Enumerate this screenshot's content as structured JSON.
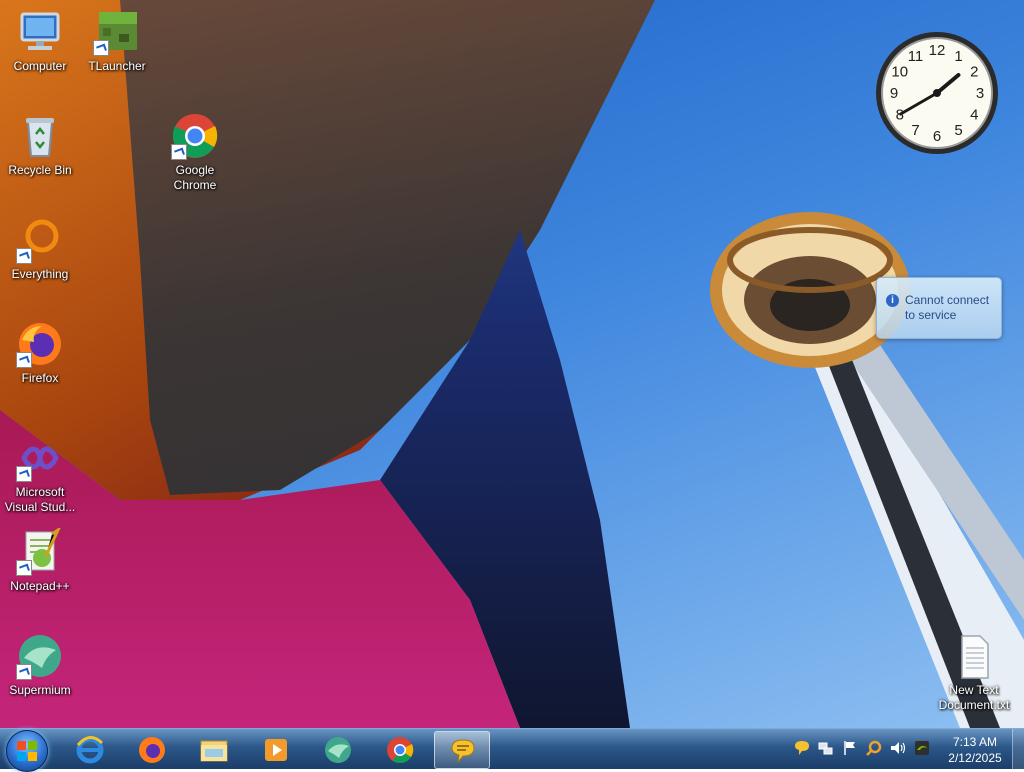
{
  "desktop_icons": [
    {
      "name": "Computer",
      "icon": "computer-icon"
    },
    {
      "name": "TLauncher",
      "icon": "tlauncher-icon"
    },
    {
      "name": "Recycle Bin",
      "icon": "recycle-bin-icon"
    },
    {
      "name": "Google\nChrome",
      "icon": "chrome-icon"
    },
    {
      "name": "Everything",
      "icon": "everything-icon"
    },
    {
      "name": "Firefox",
      "icon": "firefox-icon"
    },
    {
      "name": "Microsoft\nVisual Stud...",
      "icon": "visual-studio-icon"
    },
    {
      "name": "Notepad++",
      "icon": "notepadpp-icon"
    },
    {
      "name": "Supermium",
      "icon": "supermium-icon"
    },
    {
      "name": "New Text\nDocument.txt",
      "icon": "text-document-icon"
    }
  ],
  "clock_gadget": {
    "numerals": [
      "12",
      "1",
      "2",
      "3",
      "4",
      "5",
      "6",
      "7",
      "8",
      "9",
      "10",
      "11"
    ],
    "hour": 1,
    "minute": 40
  },
  "notification": {
    "text": "Cannot connect to service",
    "icon": "info-icon"
  },
  "taskbar": {
    "start_icon": "windows-start-icon",
    "pinned": [
      "internet-explorer-icon",
      "firefox-icon",
      "file-explorer-icon",
      "media-player-icon",
      "supermium-icon",
      "chrome-icon",
      "messaging-icon"
    ],
    "tray_icons": [
      "chat-icon",
      "network-icon",
      "action-center-flag-icon",
      "search-icon",
      "volume-icon",
      "nvidia-icon"
    ],
    "time": "7:13 AM",
    "date": "2/12/2025"
  },
  "colors": {
    "taskbar": "#1d4a80",
    "sky": "#3f86de",
    "accent": "#2b6ed0"
  }
}
